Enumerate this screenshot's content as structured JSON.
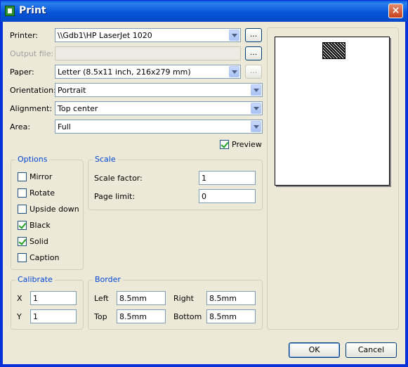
{
  "window": {
    "title": "Print",
    "close_glyph": "×"
  },
  "printer": {
    "label": "Printer:",
    "value": "\\\\Gdb1\\HP LaserJet 1020",
    "browse": "..."
  },
  "output_file": {
    "label": "Output file:",
    "value": "",
    "browse": "..."
  },
  "paper": {
    "label": "Paper:",
    "value": "Letter (8.5x11 inch, 216x279 mm)",
    "browse": "..."
  },
  "orientation": {
    "label": "Orientation:",
    "value": "Portrait"
  },
  "alignment": {
    "label": "Alignment:",
    "value": "Top center"
  },
  "area": {
    "label": "Area:",
    "value": "Full"
  },
  "preview": {
    "label": "Preview",
    "checked": true
  },
  "options": {
    "title": "Options",
    "items": [
      {
        "label": "Mirror",
        "checked": false
      },
      {
        "label": "Rotate",
        "checked": false
      },
      {
        "label": "Upside down",
        "checked": false
      },
      {
        "label": "Black",
        "checked": true
      },
      {
        "label": "Solid",
        "checked": true
      },
      {
        "label": "Caption",
        "checked": false
      }
    ]
  },
  "scale": {
    "title": "Scale",
    "factor_label": "Scale factor:",
    "factor_value": "1",
    "limit_label": "Page limit:",
    "limit_value": "0"
  },
  "calibrate": {
    "title": "Calibrate",
    "x_label": "X",
    "x_value": "1",
    "y_label": "Y",
    "y_value": "1"
  },
  "border": {
    "title": "Border",
    "left_label": "Left",
    "left_value": "8.5mm",
    "right_label": "Right",
    "right_value": "8.5mm",
    "top_label": "Top",
    "top_value": "8.5mm",
    "bottom_label": "Bottom",
    "bottom_value": "8.5mm"
  },
  "buttons": {
    "ok": "OK",
    "cancel": "Cancel"
  },
  "colors": {
    "titlebar": "#0755d8",
    "group_title": "#0046d5",
    "dialog_bg": "#ece9d8"
  }
}
